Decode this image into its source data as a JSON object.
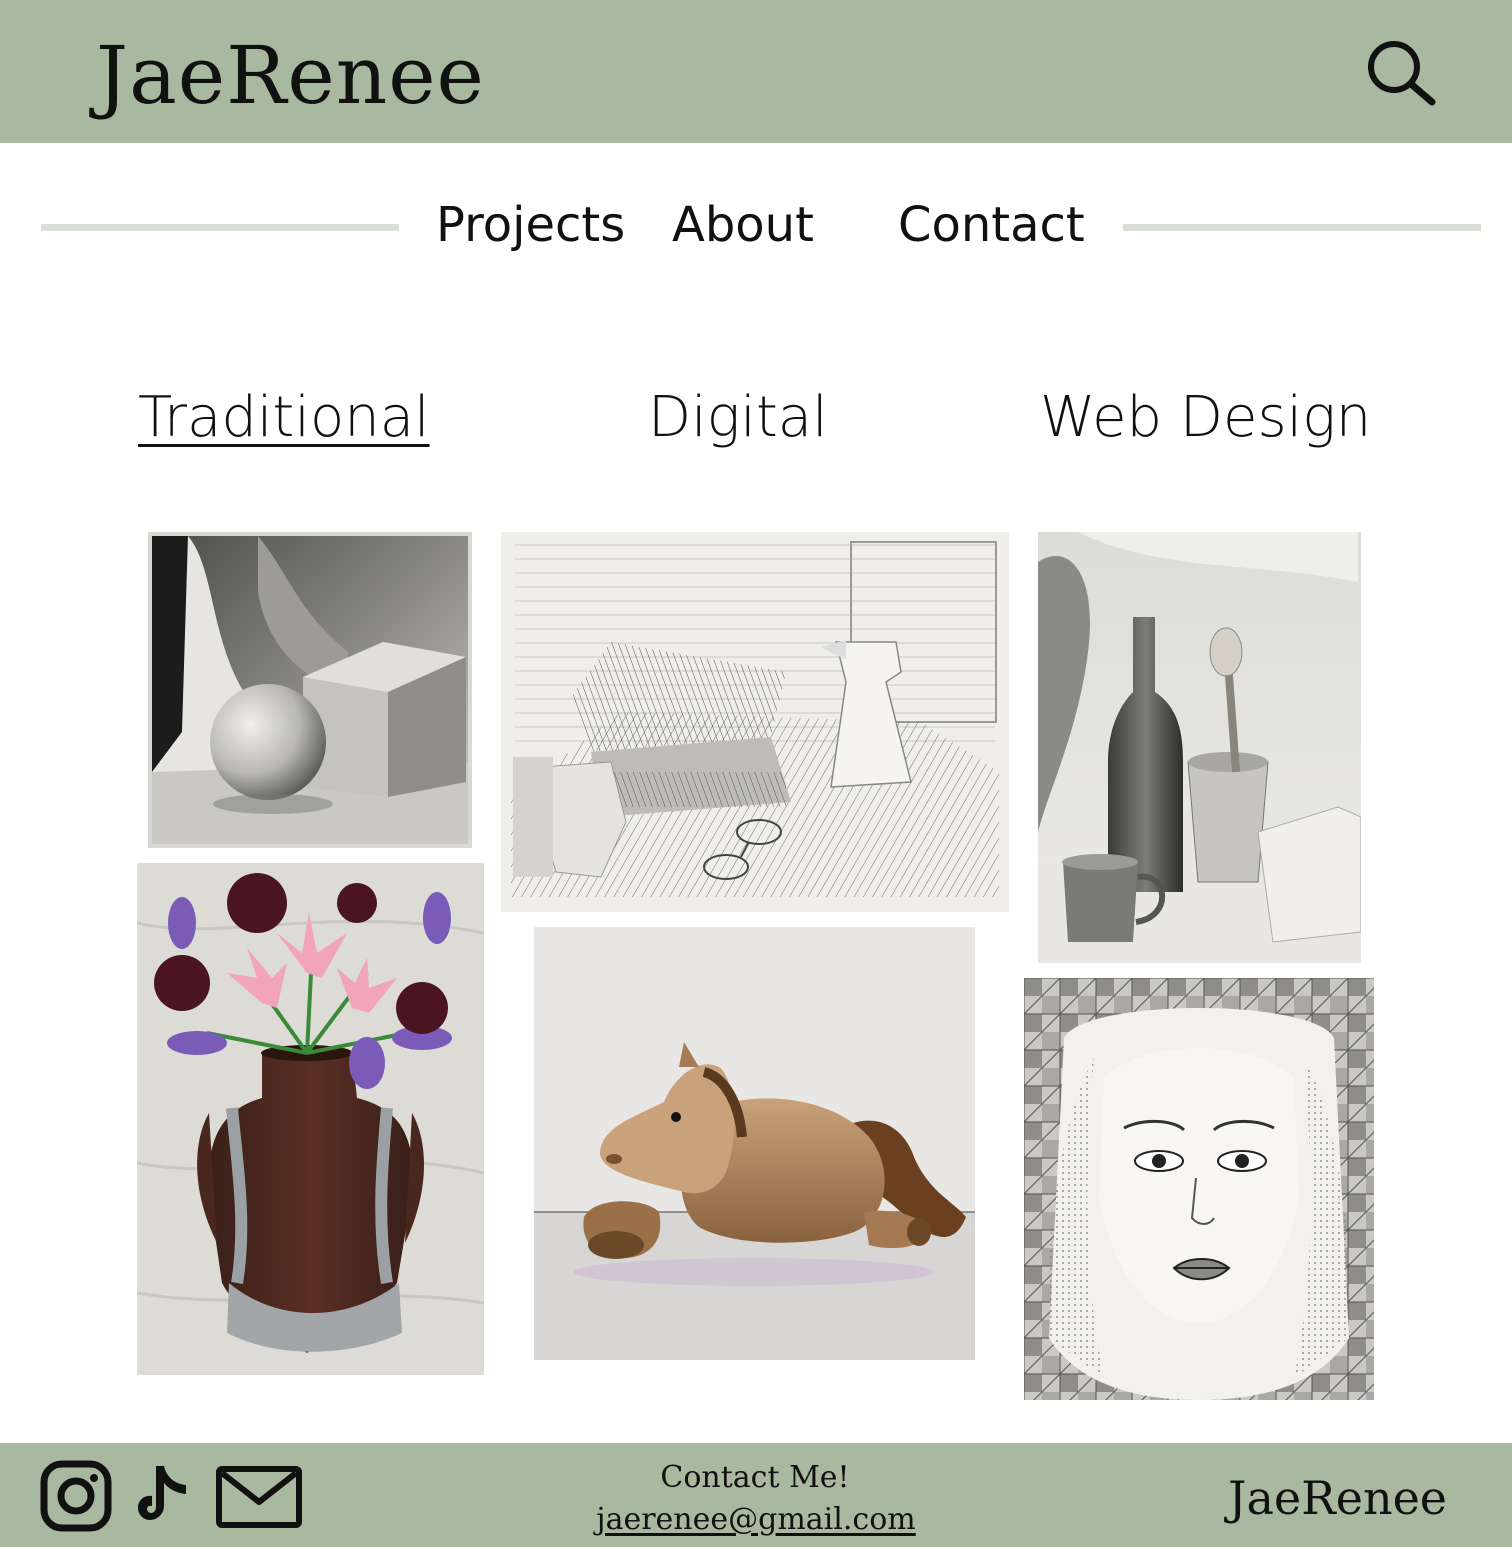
{
  "header": {
    "brand": "JaeRenee",
    "search_icon": "search-icon",
    "background_color": "#a8b9a0"
  },
  "nav": {
    "items": [
      {
        "label": "Projects"
      },
      {
        "label": "About"
      },
      {
        "label": "Contact"
      }
    ]
  },
  "tabs": {
    "items": [
      {
        "label": "Traditional",
        "active": true
      },
      {
        "label": "Digital",
        "active": false
      },
      {
        "label": "Web Design",
        "active": false
      }
    ]
  },
  "gallery": {
    "artworks": [
      {
        "subject": "charcoal still life with sphere, cube and drape"
      },
      {
        "subject": "cross-hatched still life with spray bottle, books and glasses"
      },
      {
        "subject": "pencil still life with bottle, mug and pot"
      },
      {
        "subject": "vase torso painting with lilies and flowers"
      },
      {
        "subject": "watercolor plush horse"
      },
      {
        "subject": "zentangle portrait"
      }
    ]
  },
  "footer": {
    "social_icons": [
      "instagram-icon",
      "tiktok-icon",
      "mail-icon"
    ],
    "contact_title": "Contact Me!",
    "email": "jaerenee@gmail.com",
    "brand": "JaeRenee"
  }
}
